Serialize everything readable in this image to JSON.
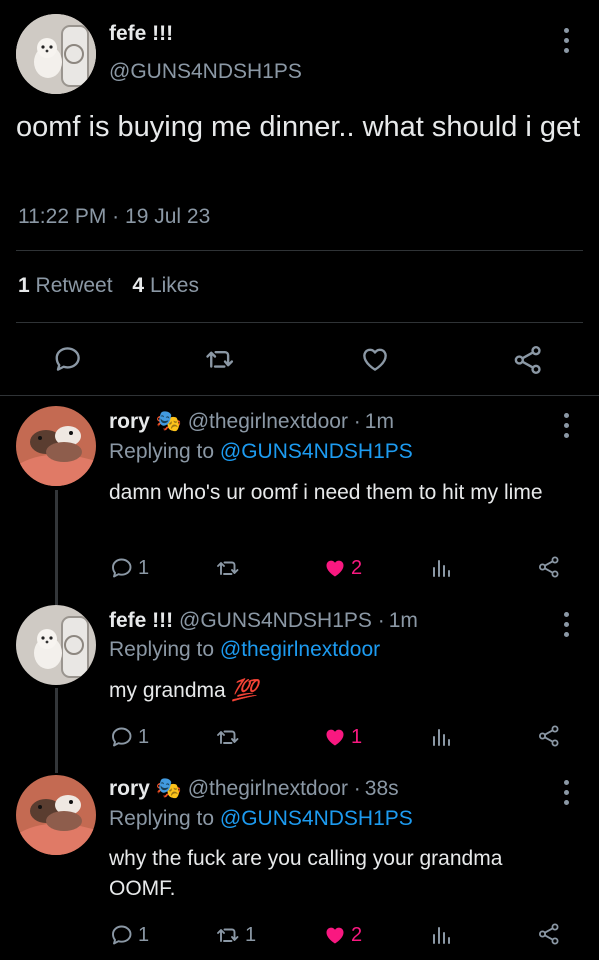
{
  "main_tweet": {
    "display_name": "fefe !!!",
    "handle": "@GUNS4NDSH1PS",
    "text": "oomf is buying me dinner.. what should i get",
    "time": "11:22 PM",
    "date": "19 Jul 23",
    "retweets_count": "1",
    "retweets_label": "Retweet",
    "likes_count": "4",
    "likes_label": "Likes"
  },
  "replies": [
    {
      "display_name": "rory",
      "emoji": "🎭",
      "handle": "@thegirlnextdoor",
      "time": "1m",
      "replying_label": "Replying to",
      "replying_to": "@GUNS4NDSH1PS",
      "text": "damn who's ur oomf i need them to hit my lime",
      "reply_count": "1",
      "retweet_count": "",
      "like_count": "2"
    },
    {
      "display_name": "fefe !!!",
      "emoji": "",
      "handle": "@GUNS4NDSH1PS",
      "time": "1m",
      "replying_label": "Replying to",
      "replying_to": "@thegirlnextdoor",
      "text": "my grandma",
      "text_emoji": "💯",
      "reply_count": "1",
      "retweet_count": "",
      "like_count": "1"
    },
    {
      "display_name": "rory",
      "emoji": "🎭",
      "handle": "@thegirlnextdoor",
      "time": "38s",
      "replying_label": "Replying to",
      "replying_to": "@GUNS4NDSH1PS",
      "text": "why the fuck are you calling your grandma OOMF.",
      "reply_count": "1",
      "retweet_count": "1",
      "like_count": "2"
    }
  ],
  "separator": "·",
  "icons": [
    "reply-icon",
    "retweet-icon",
    "like-icon",
    "share-icon",
    "views-icon",
    "more-icon"
  ],
  "colors": {
    "background": "#000000",
    "text": "#e7e9ea",
    "muted": "#8b98a5",
    "link": "#1d9bf0",
    "like": "#f91880"
  }
}
